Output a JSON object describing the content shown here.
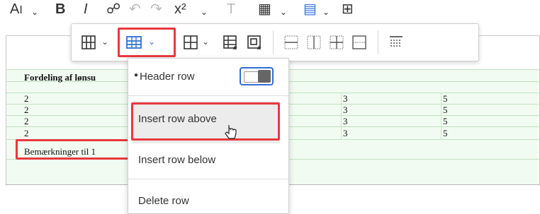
{
  "top_toolbar": {
    "font_size_label": "A",
    "bold": "B",
    "italic": "I"
  },
  "table_rows": [
    {
      "c1": "Fordeling af lønsu",
      "c2": "",
      "c3": ""
    },
    {
      "c1": "2",
      "c2": "3",
      "c3": "5"
    },
    {
      "c1": "2",
      "c2": "3",
      "c3": "5"
    },
    {
      "c1": "2",
      "c2": "3",
      "c3": "5"
    },
    {
      "c1": "2",
      "c2": "3",
      "c3": "5"
    }
  ],
  "remarks_text": "Bemærkninger til 1",
  "dropdown": {
    "header_row_label": "Header row",
    "insert_row_above_label": "Insert row above",
    "insert_row_below_label": "Insert row below",
    "delete_row_label": "Delete row"
  },
  "colors": {
    "accent": "#2f6fd6",
    "highlight": "#e8393e",
    "table_green": "#f1fbf1"
  }
}
